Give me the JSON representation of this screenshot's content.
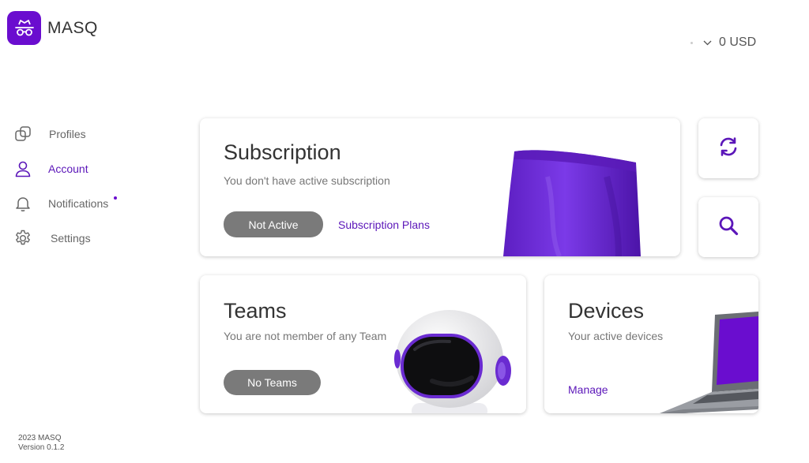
{
  "brand": {
    "name": "MASQ",
    "color": "#6a0dcf"
  },
  "balance": {
    "amount": "0 USD"
  },
  "nav": {
    "items": [
      {
        "label": "Profiles",
        "icon": "profiles-icon"
      },
      {
        "label": "Account",
        "icon": "user-icon",
        "active": true
      },
      {
        "label": "Notifications",
        "icon": "bell-icon",
        "has_unread": true
      },
      {
        "label": "Settings",
        "icon": "gear-icon"
      }
    ]
  },
  "subscription": {
    "title": "Subscription",
    "subtitle": "You don't have active subscription",
    "status": "Not Active",
    "link": "Subscription Plans"
  },
  "teams": {
    "title": "Teams",
    "subtitle": "You are not member of any Team",
    "status": "No Teams"
  },
  "devices": {
    "title": "Devices",
    "subtitle": "Your active devices",
    "link": "Manage"
  },
  "actions": {
    "refresh_icon": "refresh-icon",
    "search_icon": "search-icon"
  },
  "footer": {
    "copyright": "2023 MASQ",
    "version": "Version 0.1.2"
  }
}
